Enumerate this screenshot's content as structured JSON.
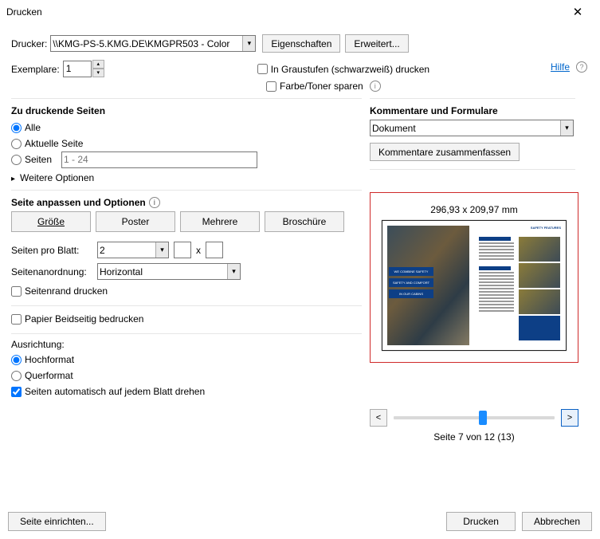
{
  "window": {
    "title": "Drucken"
  },
  "help": {
    "label": "Hilfe"
  },
  "printer": {
    "label": "Drucker:",
    "value": "\\\\KMG-PS-5.KMG.DE\\KMGPR503 - Color",
    "properties_btn": "Eigenschaften",
    "advanced_btn": "Erweitert..."
  },
  "copies": {
    "label": "Exemplare:",
    "value": "1"
  },
  "options_top": {
    "grayscale": "In Graustufen (schwarzweiß) drucken",
    "save_toner": "Farbe/Toner sparen"
  },
  "pages": {
    "title": "Zu druckende Seiten",
    "all": "Alle",
    "current": "Aktuelle Seite",
    "range_label": "Seiten",
    "range_placeholder": "1 - 24",
    "more": "Weitere Optionen"
  },
  "comments": {
    "title": "Kommentare und Formulare",
    "value": "Dokument",
    "summarize_btn": "Kommentare zusammenfassen"
  },
  "fit": {
    "title": "Seite anpassen und Optionen",
    "size": "Größe",
    "poster": "Poster",
    "multiple": "Mehrere",
    "booklet": "Broschüre"
  },
  "pps": {
    "label": "Seiten pro Blatt:",
    "value": "2",
    "x": "x"
  },
  "order": {
    "label": "Seitenanordnung:",
    "value": "Horizontal"
  },
  "border": {
    "label": "Seitenrand drucken"
  },
  "duplex": {
    "label": "Papier Beidseitig bedrucken"
  },
  "orient": {
    "title": "Ausrichtung:",
    "portrait": "Hochformat",
    "landscape": "Querformat",
    "auto": "Seiten automatisch auf jedem Blatt drehen"
  },
  "preview": {
    "dimensions": "296,93 x 209,97 mm",
    "page_info": "Seite 7 von 12 (13)",
    "band1": "WE COMBINE SAFETY",
    "band2": "SAFETY AND COMFORT",
    "band3": "IN OUR CABINS",
    "heading": "SAFETY FEATURES"
  },
  "nav": {
    "prev": "<",
    "next": ">"
  },
  "bottom": {
    "page_setup": "Seite einrichten...",
    "print": "Drucken",
    "cancel": "Abbrechen"
  }
}
